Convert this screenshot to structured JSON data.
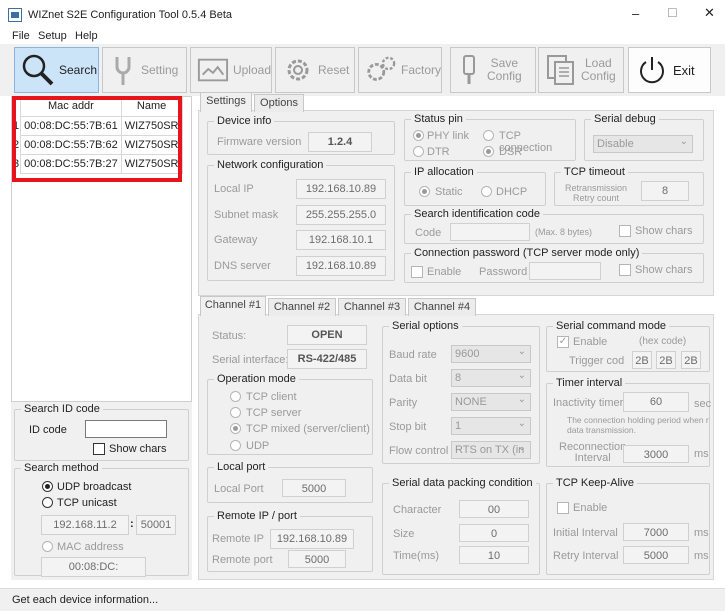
{
  "window": {
    "title": "WIZnet S2E Configuration Tool 0.5.4 Beta",
    "min": "–",
    "max": "☐",
    "close": "✕"
  },
  "menu": [
    "File",
    "Setup",
    "Help"
  ],
  "toolbar": {
    "search": "Search",
    "setting": "Setting",
    "upload": "Upload",
    "reset": "Reset",
    "factory": "Factory",
    "save1": "Save",
    "save2": "Config",
    "load1": "Load",
    "load2": "Config",
    "exit": "Exit"
  },
  "devices": {
    "headers": [
      "Mac addr",
      "Name"
    ],
    "rows": [
      {
        "num": "1",
        "mac": "00:08:DC:55:7B:61",
        "name": "WIZ750SR"
      },
      {
        "num": "2",
        "mac": "00:08:DC:55:7B:62",
        "name": "WIZ750SR"
      },
      {
        "num": "3",
        "mac": "00:08:DC:55:7B:27",
        "name": "WIZ750SR"
      }
    ]
  },
  "search_id": {
    "title": "Search ID code",
    "label": "ID code",
    "value": "",
    "show": "Show chars"
  },
  "search_method": {
    "title": "Search method",
    "udp": "UDP broadcast",
    "tcp": "TCP unicast",
    "ip": "192.168.11.2",
    "colon": ":",
    "port": "50001",
    "mac_label": "MAC address",
    "mac": "00:08:DC:"
  },
  "tabs": {
    "settings": "Settings",
    "options": "Options"
  },
  "device_info": {
    "title": "Device info",
    "fw_label": "Firmware version",
    "fw": "1.2.4"
  },
  "network": {
    "title": "Network configuration",
    "local_ip_label": "Local IP",
    "local_ip": "192.168.10.89",
    "subnet_label": "Subnet mask",
    "subnet": "255.255.255.0",
    "gw_label": "Gateway",
    "gw": "192.168.10.1",
    "dns_label": "DNS server",
    "dns": "192.168.10.89"
  },
  "status_pin": {
    "title": "Status pin",
    "phy": "PHY link",
    "tcpconn": "TCP connection",
    "dtr": "DTR",
    "dsr": "DSR"
  },
  "serial_debug": {
    "title": "Serial debug",
    "value": "Disable"
  },
  "ip_alloc": {
    "title": "IP allocation",
    "static": "Static",
    "dhcp": "DHCP"
  },
  "tcp_timeout": {
    "title": "TCP timeout",
    "label1": "Retransmission",
    "label2": "Retry count",
    "value": "8"
  },
  "search_code": {
    "title": "Search identification code",
    "code": "Code",
    "hint": "(Max. 8 bytes)",
    "show": "Show chars"
  },
  "conn_pw": {
    "title": "Connection password (TCP server mode only)",
    "enable": "Enable",
    "pw": "Password",
    "show": "Show chars"
  },
  "channels": [
    "Channel #1",
    "Channel #2",
    "Channel #3",
    "Channel #4"
  ],
  "channel": {
    "status_label": "Status:",
    "status": "OPEN",
    "iface_label": "Serial interface:",
    "iface": "RS-422/485"
  },
  "opmode": {
    "title": "Operation mode",
    "client": "TCP client",
    "server": "TCP server",
    "mixed": "TCP mixed (server/client)",
    "udp": "UDP"
  },
  "local_port": {
    "title": "Local port",
    "label": "Local Port",
    "value": "5000"
  },
  "remote": {
    "title": "Remote IP / port",
    "ip_label": "Remote IP",
    "ip": "192.168.10.89",
    "port_label": "Remote port",
    "port": "5000"
  },
  "serial_opts": {
    "title": "Serial options",
    "baud_l": "Baud rate",
    "baud": "9600",
    "data_l": "Data bit",
    "data": "8",
    "parity_l": "Parity",
    "parity": "NONE",
    "stop_l": "Stop bit",
    "stop": "1",
    "flow_l": "Flow control",
    "flow": "RTS on TX (in"
  },
  "packing": {
    "title": "Serial data packing condition",
    "char_l": "Character",
    "char": "00",
    "size_l": "Size",
    "size": "0",
    "time_l": "Time(ms)",
    "time": "10"
  },
  "cmd_mode": {
    "title": "Serial command mode",
    "enable": "Enable",
    "hex": "(hex code)",
    "trig": "Trigger cod",
    "c1": "2B",
    "c2": "2B",
    "c3": "2B"
  },
  "timer": {
    "title": "Timer interval",
    "inact": "Inactivity timer",
    "inact_v": "60",
    "sec": "sec",
    "note1": "The connection holding period when n",
    "note2": "data transmission.",
    "recon1": "Reconnection",
    "recon2": "Interval",
    "recon_v": "3000",
    "ms": "ms"
  },
  "keepalive": {
    "title": "TCP Keep-Alive",
    "enable": "Enable",
    "init_l": "Initial Interval",
    "init": "7000",
    "retry_l": "Retry Interval",
    "retry": "5000",
    "ms": "ms"
  },
  "status": "Get each device information...",
  "colors": {
    "highlight": "#e8141c",
    "active_btn": "#cce4f7"
  }
}
